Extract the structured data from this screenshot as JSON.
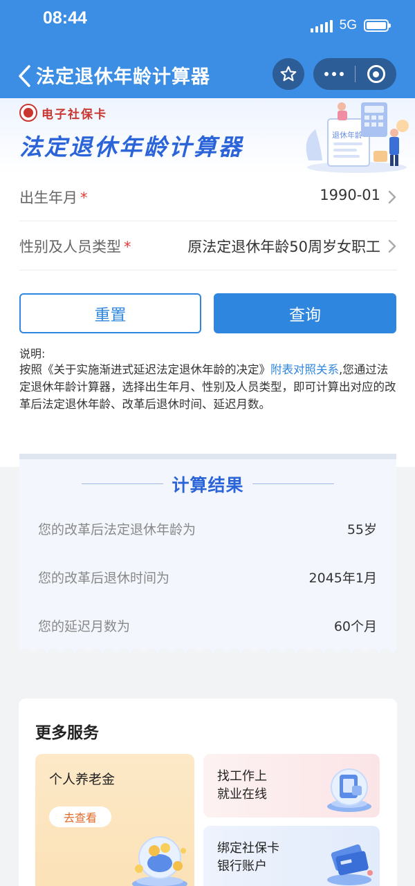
{
  "status_bar": {
    "time": "08:44",
    "network": "5G"
  },
  "nav": {
    "title": "法定退休年龄计算器"
  },
  "banner": {
    "brand": "电子社保卡",
    "title": "法定退休年龄计算器",
    "illustration_label": "退休年龄"
  },
  "form": {
    "birth": {
      "label": "出生年月",
      "required_mark": "*",
      "value": "1990-01"
    },
    "type": {
      "label": "性别及人员类型",
      "required_mark": "*",
      "value": "原法定退休年龄50周岁女职工"
    }
  },
  "buttons": {
    "reset": "重置",
    "query": "查询"
  },
  "note": {
    "title": "说明:",
    "prefix": "按照《关于实施渐进式延迟法定退休年龄的决定》",
    "link": "附表对照关系",
    "suffix": ",您通过法定退休年龄计算器，选择出生年月、性别及人员类型，即可计算出对应的改革后法定退休年龄、改革后退休时间、延迟月数。"
  },
  "result": {
    "title": "计算结果",
    "rows": [
      {
        "label": "您的改革后法定退休年龄为",
        "value": "55岁"
      },
      {
        "label": "您的改革后退休时间为",
        "value": "2045年1月"
      },
      {
        "label": "您的延迟月数为",
        "value": "60个月"
      }
    ]
  },
  "more_services": {
    "title": "更多服务",
    "pension": {
      "title": "个人养老金",
      "action": "去查看"
    },
    "job": {
      "line1": "找工作上",
      "line2": "就业在线"
    },
    "bank": {
      "line1": "绑定社保卡",
      "line2": "银行账户"
    }
  },
  "colors": {
    "primary": "#2e86de",
    "nav_bg": "#3c8ee4",
    "title_blue": "#2a64d8",
    "required": "#e23a3a",
    "brand_red": "#c8362f"
  },
  "icons": [
    "back-icon",
    "star-icon",
    "more-icon",
    "close-target-icon",
    "chevron-right-icon",
    "signal-icon",
    "battery-icon"
  ]
}
